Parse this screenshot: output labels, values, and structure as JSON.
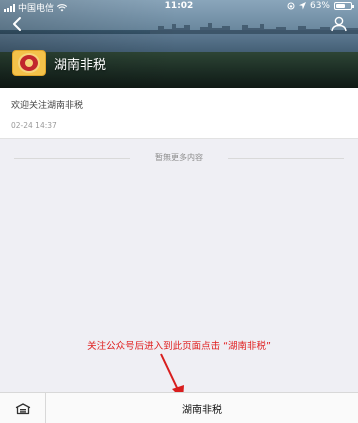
{
  "status_bar": {
    "carrier": "中国电信",
    "time": "11:02",
    "battery": "63%",
    "battery_level": 0.63
  },
  "header": {
    "account_name": "湖南非税",
    "brand_color": "#f4c24a",
    "seal_color": "#c1272d"
  },
  "message": {
    "text": "欢迎关注湖南非税",
    "time": "02-24 14:37"
  },
  "divider_text": "暂無更多内容",
  "annotation": {
    "text": "关注公众号后进入到此页面点击 “湖南非税”",
    "color": "#e02020"
  },
  "bottom_menu": {
    "keyboard_icon": "keyboard-toggle-icon",
    "item_label": "湖南非税"
  }
}
